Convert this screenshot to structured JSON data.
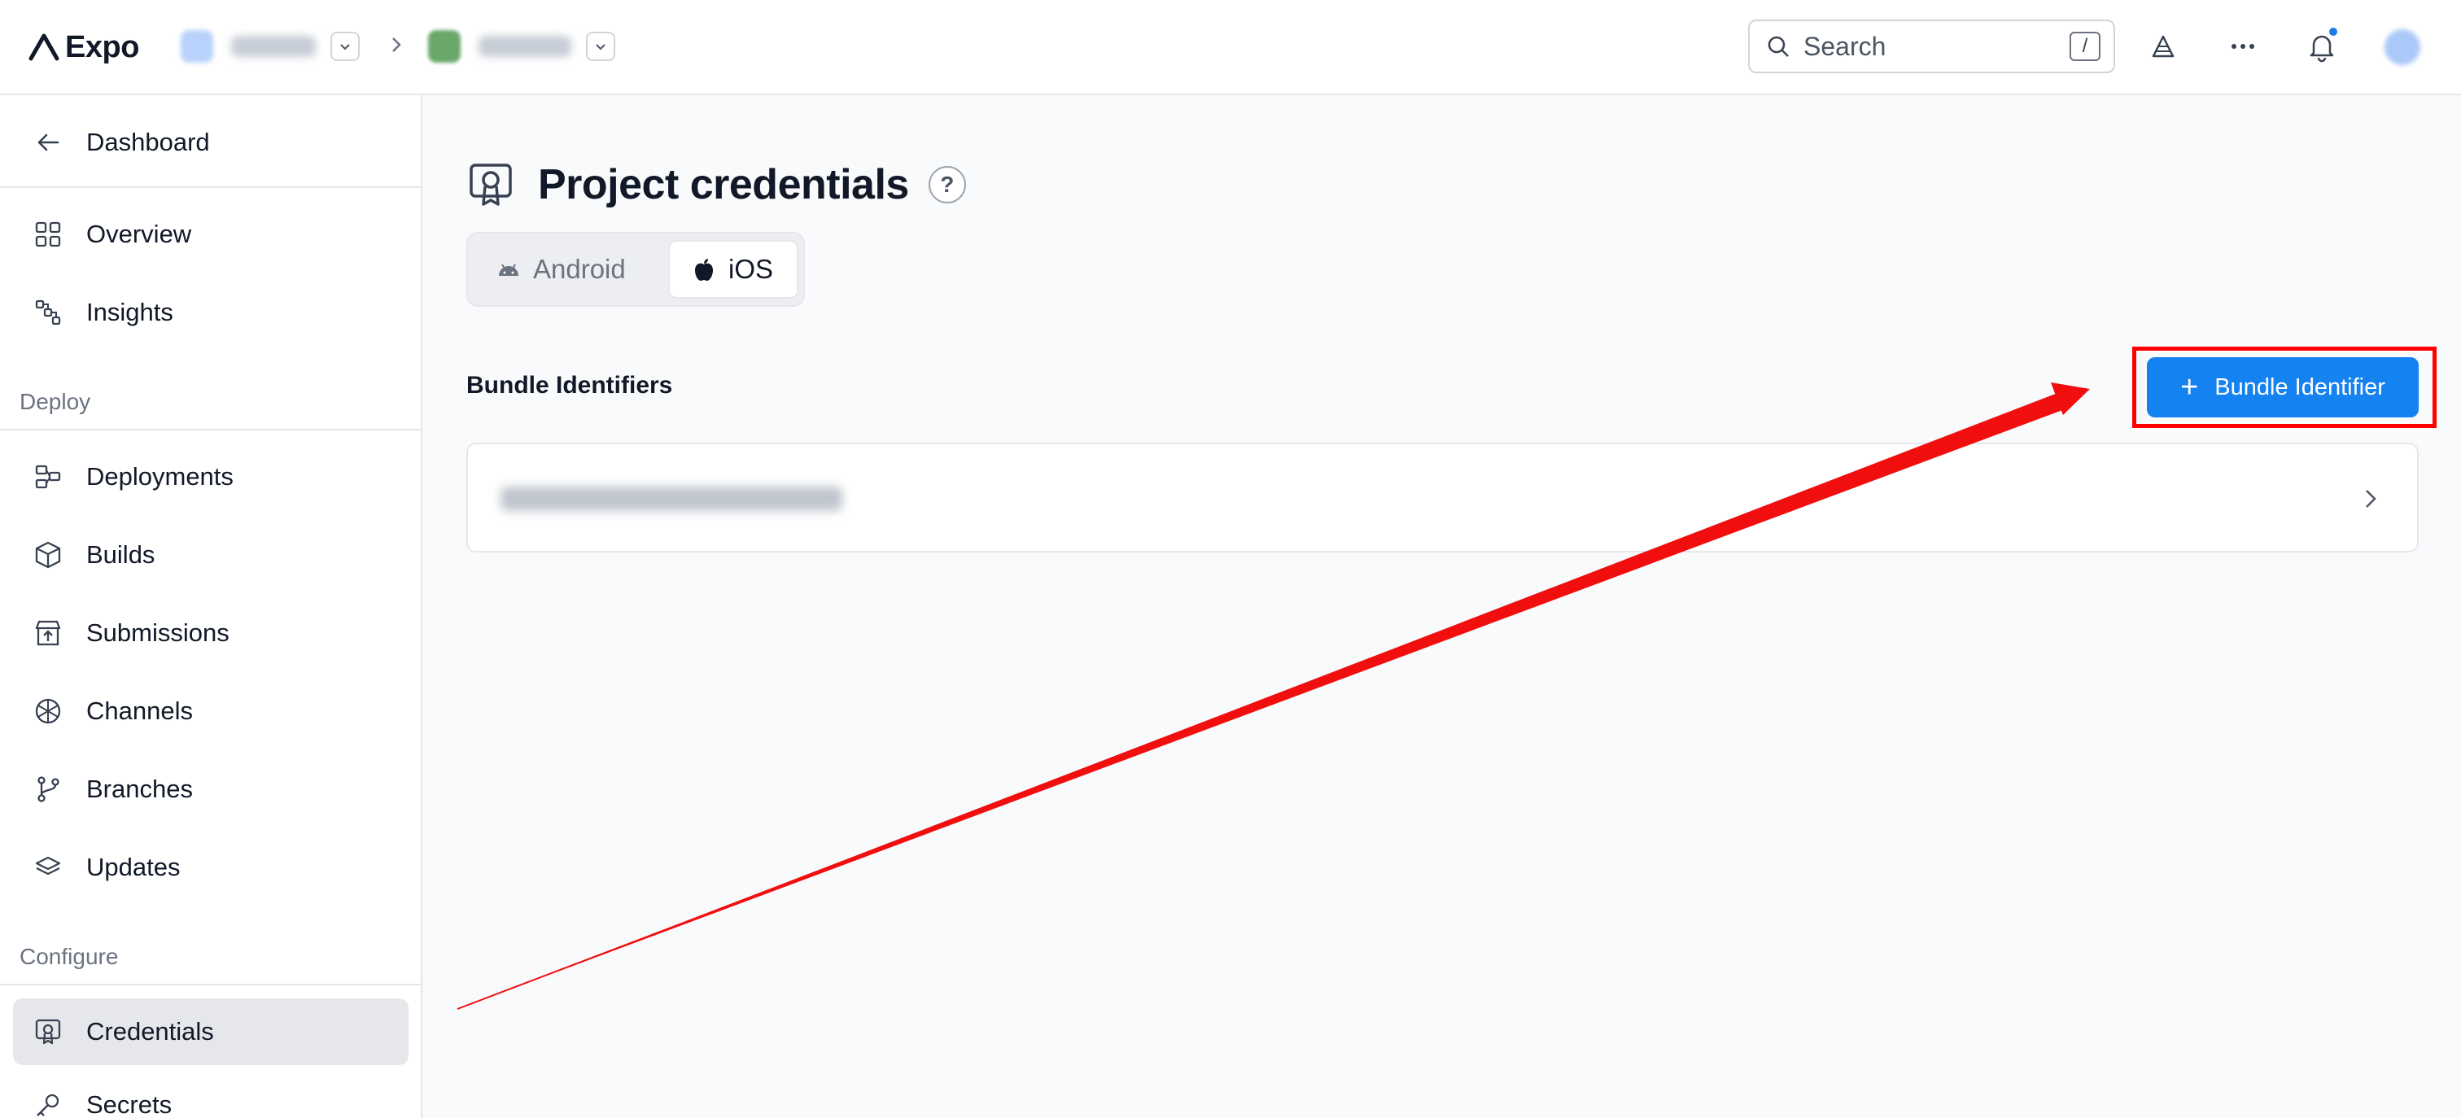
{
  "app": {
    "name": "Expo"
  },
  "header": {
    "search_placeholder": "Search",
    "search_shortcut": "/",
    "notifications_badge_color": "#1d7ae8",
    "icons": [
      "expo-go-icon",
      "more-icon",
      "bell-icon"
    ]
  },
  "sidebar": {
    "back_label": "Dashboard",
    "top_items": [
      {
        "label": "Overview",
        "icon": "grid-icon"
      },
      {
        "label": "Insights",
        "icon": "insights-icon"
      }
    ],
    "deploy_label": "Deploy",
    "deploy_items": [
      {
        "label": "Deployments",
        "icon": "deployments-icon"
      },
      {
        "label": "Builds",
        "icon": "cube-icon"
      },
      {
        "label": "Submissions",
        "icon": "store-icon"
      },
      {
        "label": "Channels",
        "icon": "channels-icon"
      },
      {
        "label": "Branches",
        "icon": "branch-icon"
      },
      {
        "label": "Updates",
        "icon": "layers-icon"
      }
    ],
    "configure_label": "Configure",
    "configure_items": [
      {
        "label": "Credentials",
        "icon": "credentials-icon",
        "active": true
      },
      {
        "label": "Secrets",
        "icon": "key-icon"
      }
    ]
  },
  "main": {
    "title": "Project credentials",
    "help": "?",
    "tabs": [
      {
        "label": "Android",
        "selected": false
      },
      {
        "label": "iOS",
        "selected": true
      }
    ],
    "section_title": "Bundle Identifiers",
    "add_button_label": "Bundle Identifier",
    "add_button_plus": "+",
    "accent_color": "#1482f0",
    "annotation_color": "#ff0000"
  }
}
